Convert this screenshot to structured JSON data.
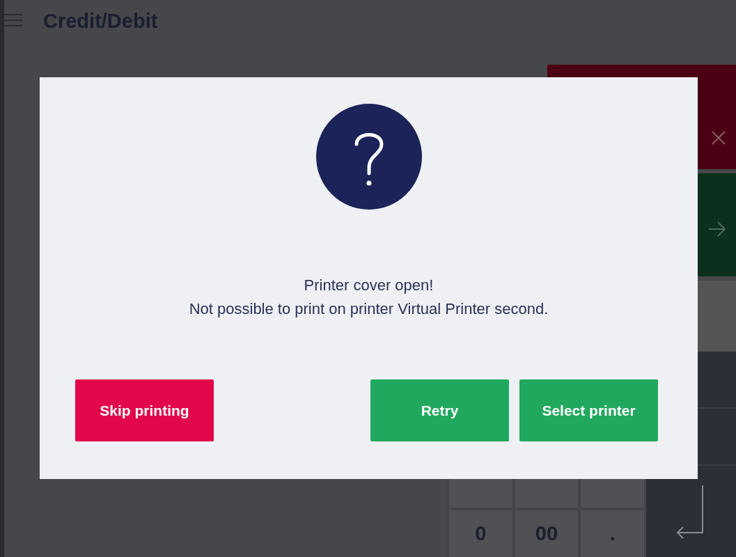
{
  "screen": {
    "title": "Credit/Debit"
  },
  "keypad": {
    "keys": [
      "0",
      "00",
      "."
    ]
  },
  "dialog": {
    "message": [
      "Printer cover open!",
      "Not possible to print on printer Virtual Printer second."
    ],
    "buttons": [
      {
        "label": "Skip printing",
        "kind": "cancel"
      },
      {
        "label": "Retry",
        "kind": "confirm"
      },
      {
        "label": "Select printer",
        "kind": "confirm"
      }
    ]
  }
}
